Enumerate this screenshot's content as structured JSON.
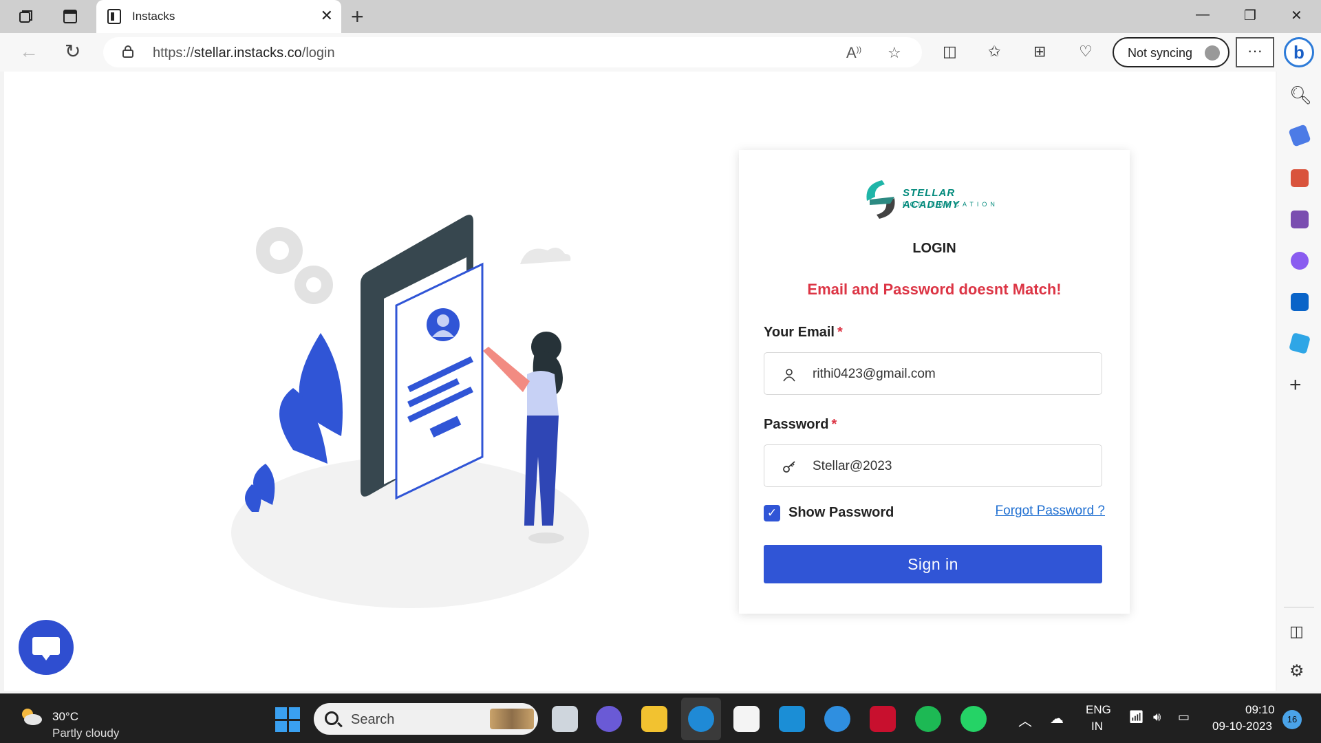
{
  "browser": {
    "tab_title": "Instacks",
    "url_prefix": "https://",
    "url_host": "stellar.instacks.co",
    "url_path": "/login",
    "sync_label": "Not syncing",
    "more_label": "···",
    "bing_label": "b"
  },
  "login": {
    "brand": "STELLAR ACADEMY",
    "brand_sub": "FOR EDUCATION",
    "heading": "LOGIN",
    "error": "Email and Password doesnt Match!",
    "email_label": "Your Email",
    "email_value": "rithi0423@gmail.com",
    "password_label": "Password",
    "password_value": "Stellar@2023",
    "required_mark": "*",
    "show_password_label": "Show Password",
    "show_password_checked": true,
    "forgot_label": "Forgot Password ?",
    "signin_label": "Sign in",
    "accent": "#3055d6",
    "error_color": "#dc3545"
  },
  "taskbar": {
    "temp": "30°C",
    "weather": "Partly cloudy",
    "search_label": "Search",
    "lang_top": "ENG",
    "lang_bottom": "IN",
    "time": "09:10",
    "date": "09-10-2023",
    "notifications": "16"
  }
}
